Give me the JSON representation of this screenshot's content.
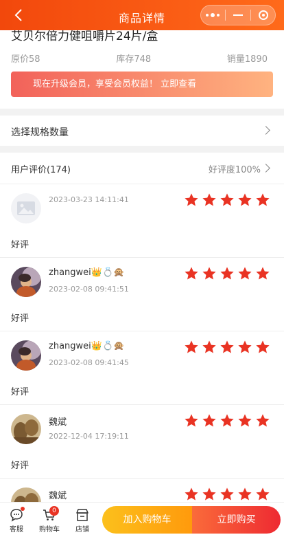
{
  "header": {
    "title": "商品详情",
    "back_icon": "chevron-left-icon",
    "capsule_icons": [
      "more-dots-icon",
      "minimize-icon",
      "close-target-icon"
    ]
  },
  "product": {
    "name": "艾贝尔倍力健咀嚼片24片/盒",
    "original_price": "原价58",
    "stock": "库存748",
    "sales": "销量1890",
    "vip_banner": "现在升级会员，享受会员权益！ 立即查看"
  },
  "spec": {
    "label": "选择规格数量"
  },
  "reviews": {
    "title": "用户评价(174)",
    "rate": "好评度100%",
    "items": [
      {
        "user": "",
        "time": "2023-03-23 14:11:41",
        "stars": 5,
        "comment": "好评",
        "avatar": "placeholder-image-icon"
      },
      {
        "user": "zhangwei👑💍🙊",
        "time": "2023-02-08 09:41:51",
        "stars": 5,
        "comment": "好评",
        "avatar": "user-photo"
      },
      {
        "user": "zhangwei👑💍🙊",
        "time": "2023-02-08 09:41:45",
        "stars": 5,
        "comment": "好评",
        "avatar": "user-photo"
      },
      {
        "user": "魏斌",
        "time": "2022-12-04 17:19:11",
        "stars": 5,
        "comment": "好评",
        "avatar": "user-photo"
      },
      {
        "user": "魏斌",
        "time": "",
        "stars": 5,
        "comment": "",
        "avatar": "user-photo"
      }
    ]
  },
  "bottom_bar": {
    "service": "客服",
    "cart": "购物车",
    "cart_count": "0",
    "shop": "店铺",
    "add_to_cart": "加入购物车",
    "buy_now": "立即购买"
  },
  "colors": {
    "header": "#f2480c",
    "star": "#e93323",
    "cart_button": "#fcc01c",
    "buy_button": "#ee2a32"
  }
}
